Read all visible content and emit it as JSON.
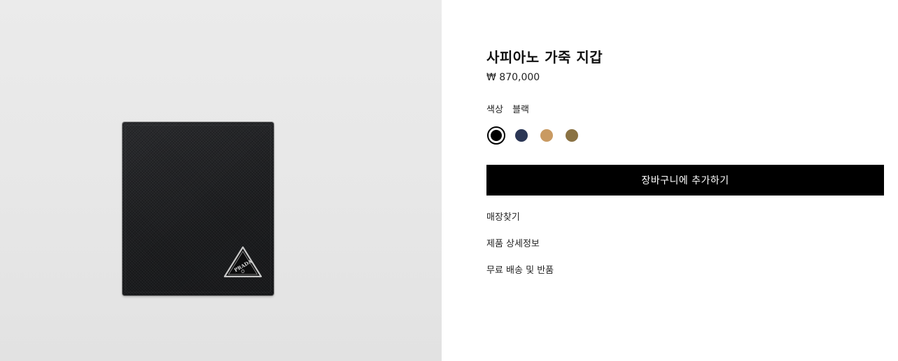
{
  "product": {
    "title": "사피아노 가죽 지갑",
    "price": "₩ 870,000",
    "color_label": "색상",
    "color_value": "블랙",
    "swatches": [
      {
        "name": "블랙",
        "hex": "#000000",
        "selected": true
      },
      {
        "name": "navy",
        "hex": "#2b3655",
        "selected": false
      },
      {
        "name": "tan",
        "hex": "#c99a62",
        "selected": false
      },
      {
        "name": "olive-brown",
        "hex": "#8a7243",
        "selected": false
      }
    ],
    "image": {
      "logo_text": "PRADA",
      "wallet_color": "#1f2022",
      "background_color": "#e8e8e8"
    }
  },
  "actions": {
    "add_to_cart_label": "장바구니에 추가하기",
    "find_store_label": "매장찾기",
    "product_details_label": "제품 상세정보",
    "shipping_returns_label": "무료 배송 및 반품"
  }
}
